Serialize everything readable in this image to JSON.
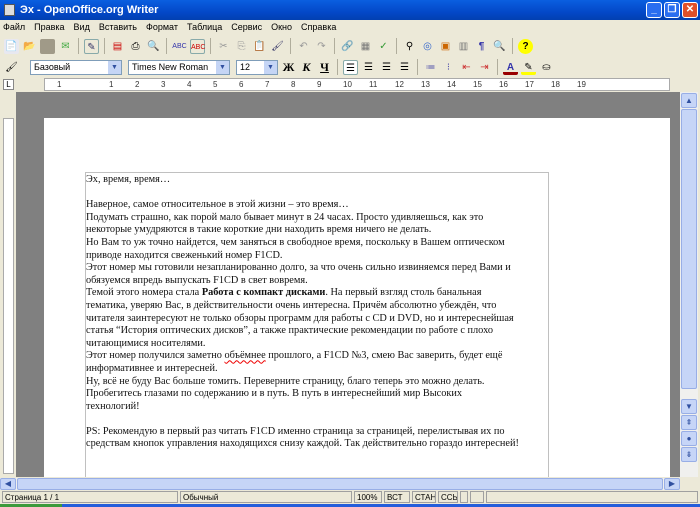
{
  "window": {
    "title": "Эх - OpenOffice.org Writer"
  },
  "menu": [
    "Файл",
    "Правка",
    "Вид",
    "Вставить",
    "Формат",
    "Таблица",
    "Сервис",
    "Окно",
    "Справка"
  ],
  "format": {
    "style": "Базовый",
    "font": "Times New Roman",
    "size": "12",
    "bold": "Ж",
    "italic": "К",
    "underline": "Ч"
  },
  "ruler": [
    "1",
    "1",
    "2",
    "3",
    "4",
    "5",
    "6",
    "7",
    "8",
    "9",
    "10",
    "11",
    "12",
    "13",
    "14",
    "15",
    "16",
    "17",
    "18",
    "19"
  ],
  "document": {
    "lines": [
      "Эх, время, время…",
      "",
      "Наверное, самое относительное в этой жизни – это время…",
      "Подумать страшно,  как порой мало бывает минут в 24 часах. Просто удивляешься, как это",
      "некоторые умудряются в такие короткие дни находить время ничего не делать.",
      "Но Вам то уж точно найдется, чем заняться в свободное время, поскольку в Вашем оптическом",
      "приводе находится свеженький номер F1CD.",
      "Этот номер мы готовили незапланированно долго,  за что очень сильно извиняемся перед Вами и",
      "обязуемся впредь выпускать F1CD в свет вовремя."
    ],
    "bold_line": {
      "before": "Темой этого номера стала ",
      "bold": "Работа с компакт дисками",
      "after": ". На первый взгляд столь банальная"
    },
    "lines2": [
      "тематика, уверяю Вас,  в действительности очень интересна. Причём абсолютно убеждён, что",
      "читателя заинтересуют не только обзоры программ для работы с CD и DVD, но и интереснейшая",
      "статья “История оптических дисков”, а также практические рекомендации по работе с плохо",
      "читающимися носителями."
    ],
    "spell_line": {
      "before": "Этот номер получился заметно ",
      "misspelled": "объёмнее",
      "after": " прошлого, а F1CD №3, смею Вас заверить, будет ещё"
    },
    "lines3": [
      "информативнее и интересней.",
      "Ну, всё не буду Вас больше томить. Переверните страницу, благо теперь это можно делать.",
      "Пробегитесь глазами по содержанию и  в путь. В путь в  интереснейший мир Высоких",
      "технологий!",
      "",
      "PS: Рекомендую в первый раз читать F1CD именно страница за страницей, перелистывая их по",
      "средствам кнопок управления находящихся снизу каждой. Так действительно гораздо интересней!"
    ]
  },
  "status": {
    "page": "Страница  1 / 1",
    "style": "Обычный",
    "zoom": "100%",
    "insert": "ВСТ",
    "mode": "СТАНД",
    "link": "ССЫЛ"
  }
}
